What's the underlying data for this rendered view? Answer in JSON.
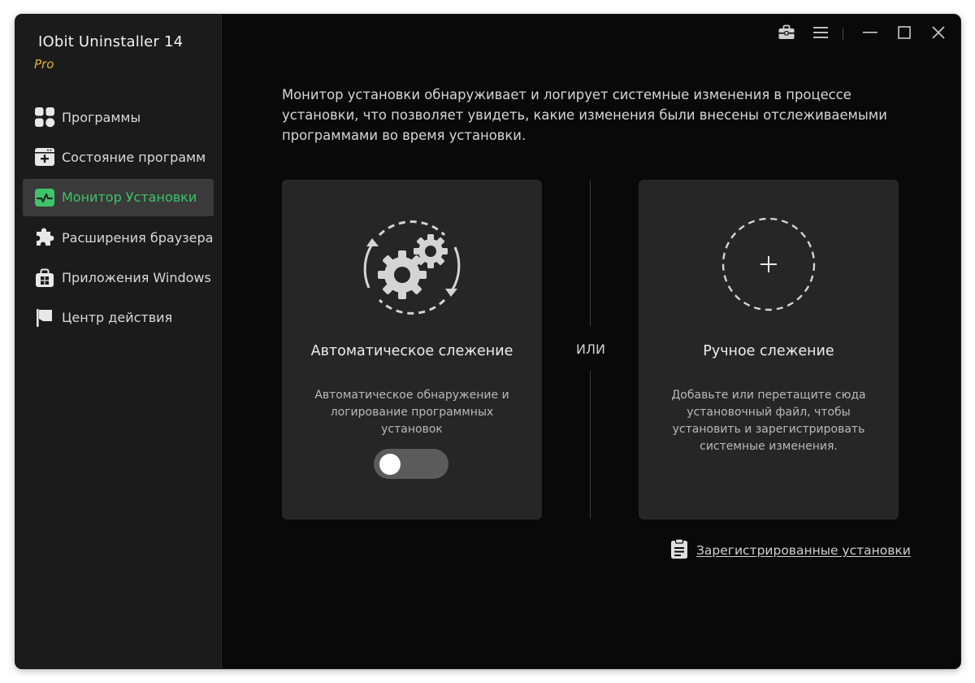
{
  "app": {
    "title": "IObit Uninstaller 14",
    "edition": "Pro",
    "accent_color": "#3dc569",
    "edition_color": "#e5b02a"
  },
  "titlebar": {
    "buttons": [
      "toolbox-icon",
      "menu-icon",
      "minimize-icon",
      "maximize-icon",
      "close-icon"
    ]
  },
  "sidebar": {
    "items": [
      {
        "label": "Программы",
        "icon": "apps-grid-icon",
        "active": false
      },
      {
        "label": "Состояние программ",
        "icon": "software-health-icon",
        "active": false
      },
      {
        "label": "Монитор Установки",
        "icon": "install-monitor-icon",
        "active": true
      },
      {
        "label": "Расширения браузера",
        "icon": "puzzle-piece-icon",
        "active": false
      },
      {
        "label": "Приложения Windows",
        "icon": "windows-store-icon",
        "active": false
      },
      {
        "label": "Центр действия",
        "icon": "flag-icon",
        "active": false
      }
    ]
  },
  "main": {
    "description": "Монитор установки обнаруживает и логирует системные изменения в процессе установки, что позволяет увидеть, какие изменения были внесены отслеживаемыми программами во время установки.",
    "auto_card": {
      "title": "Автоматическое слежение",
      "description": "Автоматическое обнаружение и логирование программных установок",
      "toggle_on": false
    },
    "or_label": "ИЛИ",
    "manual_card": {
      "title": "Ручное слежение",
      "description": "Добавьте или перетащите сюда установочный файл, чтобы установить и зарегистрировать системные изменения."
    },
    "logged_installs_link": "Зарегистрированные установки"
  }
}
